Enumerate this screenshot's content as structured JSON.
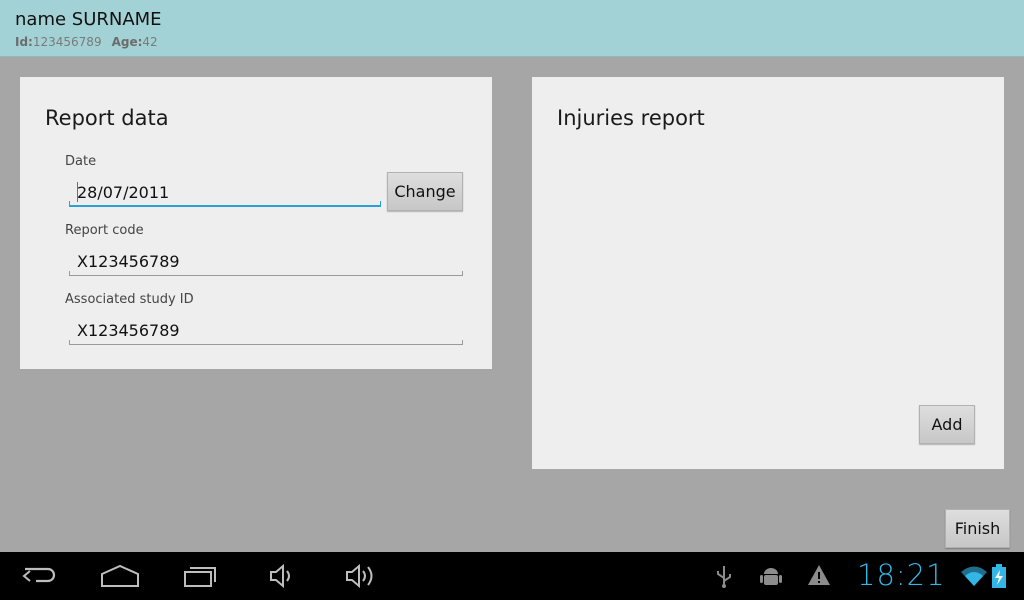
{
  "header": {
    "patient_name": "name SURNAME",
    "id_label": "Id:",
    "id_value": "123456789",
    "age_label": "Age:",
    "age_value": "42"
  },
  "report_data": {
    "title": "Report data",
    "date_label": "Date",
    "date_value": "28/07/2011",
    "change_button": "Change",
    "report_code_label": "Report code",
    "report_code_value": "X123456789",
    "study_id_label": "Associated study ID",
    "study_id_value": "X123456789"
  },
  "injuries": {
    "title": "Injuries report",
    "add_button": "Add"
  },
  "finish_button": "Finish",
  "system_bar": {
    "clock": "18:21",
    "accent_color": "#33b5e5",
    "nav_icons": [
      "back-icon",
      "home-icon",
      "recent-apps-icon",
      "volume-down-icon",
      "volume-up-icon"
    ],
    "status_icons": [
      "usb-icon",
      "android-debug-icon",
      "warning-icon",
      "wifi-icon",
      "battery-charging-icon"
    ]
  }
}
